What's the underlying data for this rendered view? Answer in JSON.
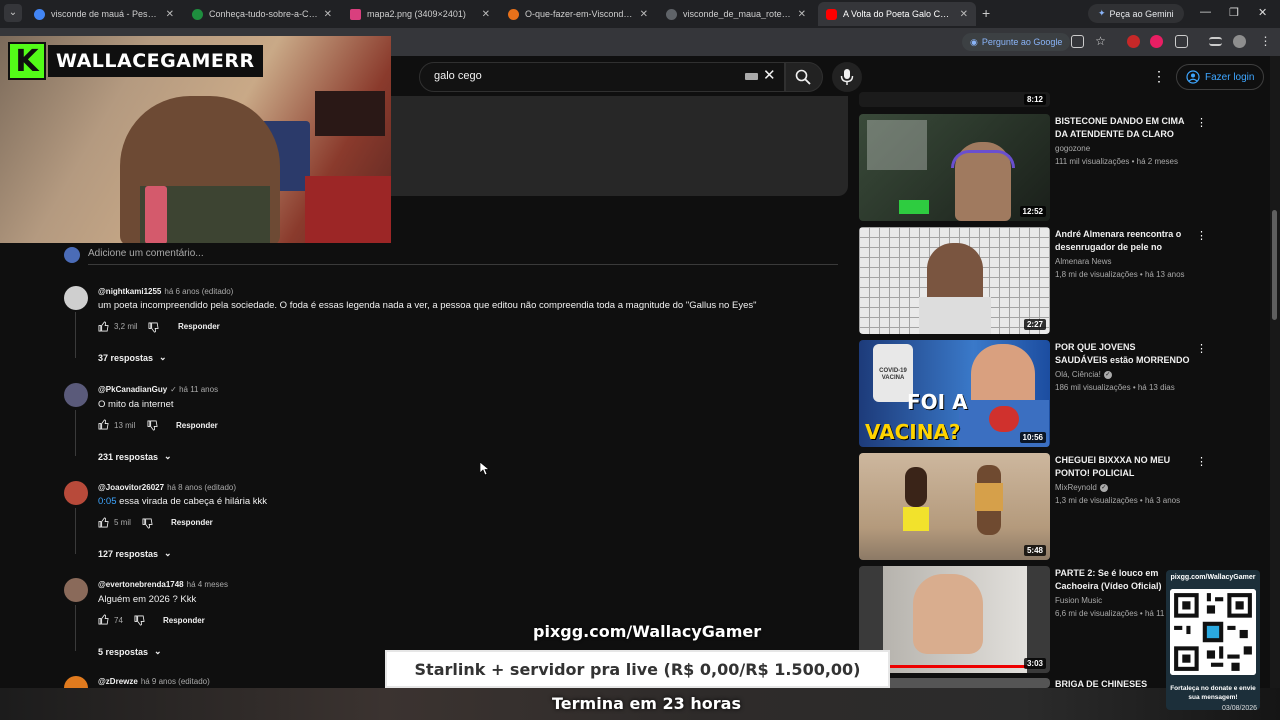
{
  "browser": {
    "tabs": [
      {
        "label": "visconde de mauá - Pesquisa Google",
        "color": "#4285f4"
      },
      {
        "label": "Conheça-tudo-sobre-a-Cachoeira",
        "color": "#1e8e3e"
      },
      {
        "label": "mapa2.png (3409×2401)",
        "color": "#d93f7e"
      },
      {
        "label": "O-que-fazer-em-Visconde-de-Mauá",
        "color": "#e8711a"
      },
      {
        "label": "visconde_de_maua_roteiros-34",
        "color": "#5f6368"
      },
      {
        "label": "A Volta do Poeta Galo Cego - Du",
        "color": "#ff0000"
      }
    ],
    "gemini_label": "Peça ao Gemini",
    "ask_google_label": "Pergunte ao Google"
  },
  "youtube": {
    "search_value": "galo cego",
    "login_label": "Fazer login"
  },
  "stream": {
    "channel_logo_letter": "K",
    "channel_name": "WALLACEGAMERR",
    "pix_url": "pixgg.com/WallacyGamer",
    "goal_text": "Starlink + servidor pra live (R$ 0,00/R$ 1.500,00)",
    "ends_text": "Termina em 23 horas",
    "qr_header": "pixgg.com/WallacyGamer",
    "qr_note": "Fortaleça no donate e envie sua mensagem!",
    "taskbar_date": "03/08/2026"
  },
  "comments": {
    "add_placeholder": "Adicione um comentário...",
    "items": [
      {
        "author": "@nightkami1255",
        "meta": "há 6 anos (editado)",
        "text": "um poeta incompreendido pela sociedade. O foda é essas legenda nada a ver, a pessoa que editou não compreendia toda a magnitude do \"Gallus no Eyes\"",
        "likes": "3,2 mil",
        "reply": "Responder",
        "replies": "37 respostas",
        "avatar_color": "#cfcfcf"
      },
      {
        "author": "@PkCanadianGuy",
        "meta": "✓ há 11 anos",
        "text": "O mito da internet",
        "likes": "13 mil",
        "reply": "Responder",
        "replies": "231 respostas",
        "avatar_color": "#5a5a7a"
      },
      {
        "author": "@Joaovitor26027",
        "meta": "há 8 anos (editado)",
        "timestamp": "0:05",
        "text": " essa virada de cabeça é hilária kkk",
        "likes": "5 mil",
        "reply": "Responder",
        "replies": "127 respostas",
        "avatar_color": "#b84a3a"
      },
      {
        "author": "@evertonebrenda1748",
        "meta": "há 4 meses",
        "text": "Alguém em 2026 ? Kkk",
        "likes": "74",
        "reply": "Responder",
        "replies": "5 respostas",
        "avatar_color": "#8a6a5a"
      },
      {
        "author": "@zDrewze",
        "meta": "há 9 anos (editado)",
        "avatar_color": "#e07a1e"
      }
    ]
  },
  "sidebar": {
    "videos": [
      {
        "duration": "8:12"
      },
      {
        "title": "BISTECONE DANDO EM CIMA DA ATENDENTE DA CLARO",
        "channel": "gogozone",
        "stats": "111 mil visualizações • há 2 meses",
        "duration": "12:52",
        "verified": false
      },
      {
        "title": "André Almenara reencontra o desenrugador de pele no centr...",
        "channel": "Almenara News",
        "stats": "1,8 mi de visualizações • há 13 anos",
        "duration": "2:27",
        "verified": false
      },
      {
        "title": "POR QUE JOVENS SAUDÁVEIS estão MORRENDO DE INFARTO?",
        "channel": "Olá, Ciência!",
        "stats": "186 mil visualizações • há 13 dias",
        "duration": "10:56",
        "verified": true,
        "thumb_text_1": "COVID-19 VACINA",
        "thumb_text_2": "FOI A",
        "thumb_text_3": "VACINA?"
      },
      {
        "title": "CHEGUEI BIXXXA NO MEU PONTO! POLICIAL DISFARÇAD...",
        "channel": "MixReynold",
        "stats": "1,3 mi de visualizações • há 3 anos",
        "duration": "5:48",
        "verified": true
      },
      {
        "title": "PARTE 2: Se é louco em Cachoeira (Vídeo Oficial) -",
        "channel": "Fusion Music",
        "stats": "6,6 mi de visualizações • há 11",
        "duration": "3:03",
        "verified": false
      },
      {
        "title": "BRIGA DE CHINESES"
      }
    ]
  }
}
